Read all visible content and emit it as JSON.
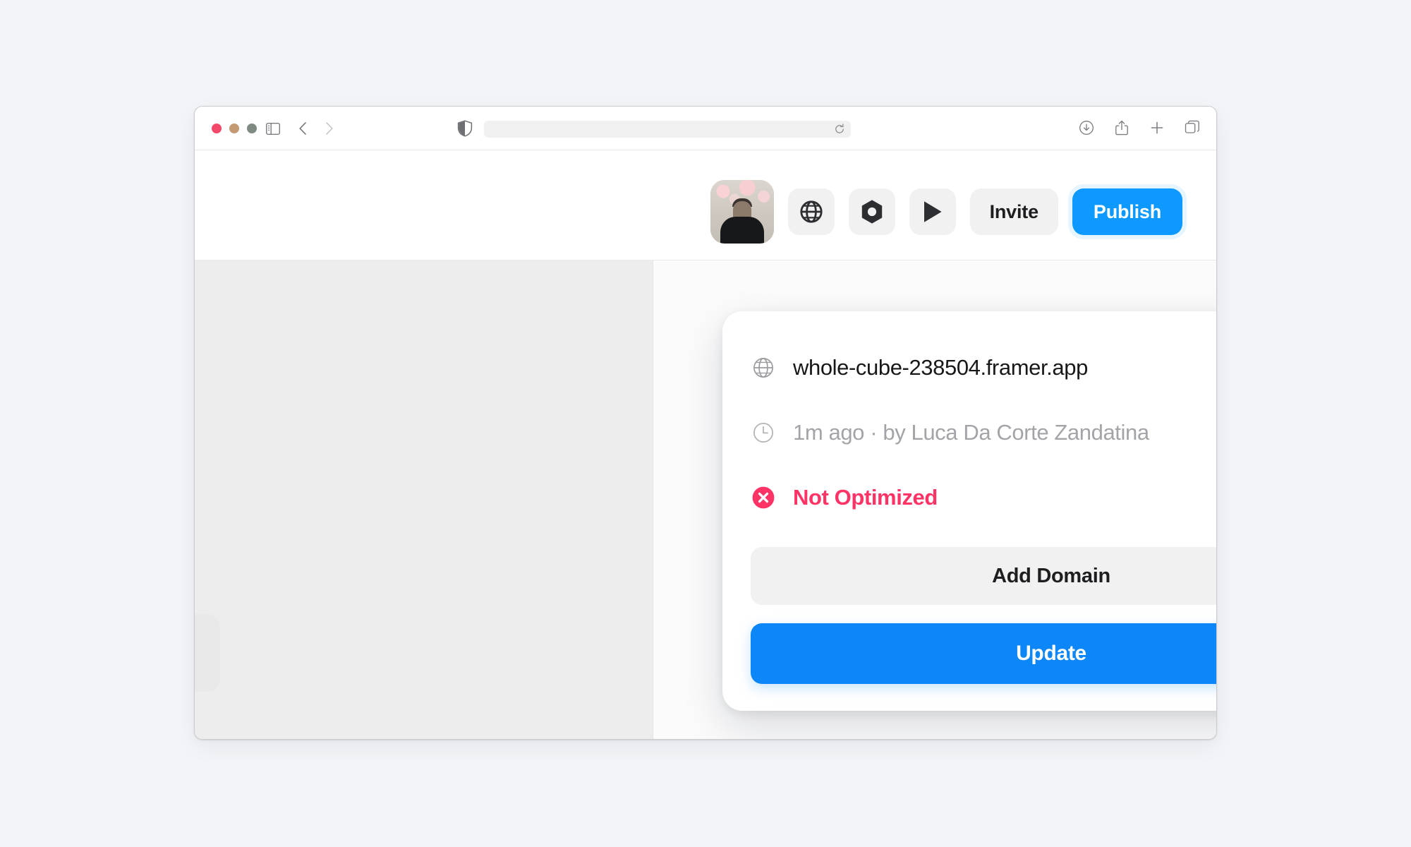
{
  "browser": {
    "traffic_lights": [
      {
        "name": "close",
        "color": "#f2496b"
      },
      {
        "name": "minimize",
        "color": "#c39a72"
      },
      {
        "name": "zoom",
        "color": "#7f8a81"
      }
    ],
    "sidebar_toggle_icon": "sidebar-icon",
    "back_icon": "chevron-left-icon",
    "forward_icon": "chevron-right-icon",
    "shield_icon": "shield-icon",
    "url_value": "",
    "url_placeholder": "",
    "reload_icon": "reload-icon",
    "right_icons": [
      {
        "name": "downloads-icon"
      },
      {
        "name": "share-icon"
      },
      {
        "name": "new-tab-icon"
      },
      {
        "name": "tab-overview-icon"
      }
    ]
  },
  "framer": {
    "avatar_label": "User avatar",
    "toolbar": {
      "globe_icon": "globe-icon",
      "component_icon": "hexagon-component-icon",
      "preview_icon": "play-icon",
      "invite_label": "Invite",
      "publish_label": "Publish"
    }
  },
  "popover": {
    "domain": {
      "icon": "globe-icon",
      "text": "whole-cube-238504.framer.app"
    },
    "updated": {
      "icon": "clock-icon",
      "text": "1m ago · by Luca Da Corte Zandatina",
      "chevron": "chevron-right-icon"
    },
    "status": {
      "icon": "error-circle-icon",
      "text": "Not Optimized",
      "color": "#ff3366",
      "chevron": "chevron-right-icon"
    },
    "add_domain_label": "Add Domain",
    "update_label": "Update"
  },
  "colors": {
    "accent_blue": "#0d99ff",
    "update_blue": "#0d86f8",
    "error_pink": "#ff3366",
    "page_background": "#f2f4f7"
  }
}
